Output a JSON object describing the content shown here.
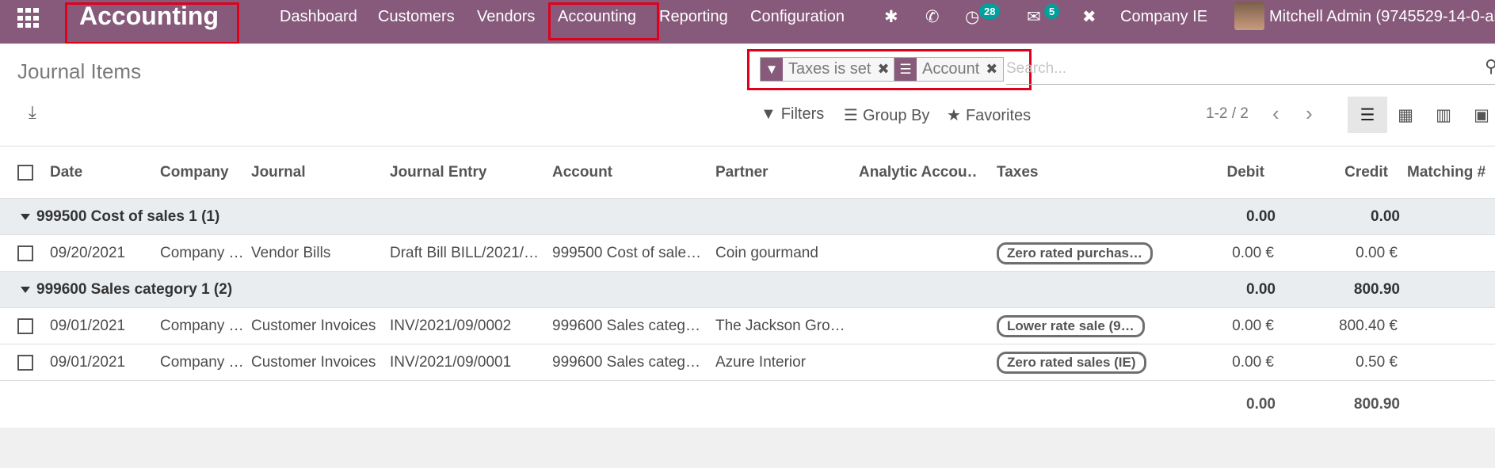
{
  "topbar": {
    "app_title": "Accounting",
    "menu": [
      "Dashboard",
      "Customers",
      "Vendors",
      "Accounting",
      "Reporting",
      "Configuration"
    ],
    "activity_count": "28",
    "message_count": "5",
    "company": "Company IE",
    "user": "Mitchell Admin (9745529-14-0-all"
  },
  "control": {
    "title": "Journal Items",
    "facets": [
      {
        "icon": "filter-icon",
        "label": "Taxes is set"
      },
      {
        "icon": "group-by-icon",
        "label": "Account"
      }
    ],
    "search_placeholder": "Search...",
    "filters_label": "Filters",
    "groupby_label": "Group By",
    "favorites_label": "Favorites",
    "pager": "1-2 / 2",
    "views": [
      "list-view-icon",
      "pivot-view-icon",
      "graph-view-icon",
      "kanban-view-icon"
    ]
  },
  "table": {
    "headers": [
      "Date",
      "Company",
      "Journal",
      "Journal Entry",
      "Account",
      "Partner",
      "Analytic Accou…",
      "Taxes",
      "Debit",
      "Credit",
      "Matching #"
    ],
    "groups": [
      {
        "label": "999500 Cost of sales 1 (1)",
        "debit": "0.00",
        "credit": "0.00",
        "rows": [
          {
            "date": "09/20/2021",
            "company": "Company …",
            "journal": "Vendor Bills",
            "entry": "Draft Bill BILL/2021/…",
            "account": "999500 Cost of sale…",
            "partner": "Coin gourmand",
            "analytic": "",
            "tax": "Zero rated purchas…",
            "debit": "0.00 €",
            "credit": "0.00 €",
            "matching": ""
          }
        ]
      },
      {
        "label": "999600 Sales category 1 (2)",
        "debit": "0.00",
        "credit": "800.90",
        "rows": [
          {
            "date": "09/01/2021",
            "company": "Company …",
            "journal": "Customer Invoices",
            "entry": "INV/2021/09/0002",
            "account": "999600 Sales categ…",
            "partner": "The Jackson Gro…",
            "analytic": "",
            "tax": "Lower rate sale (9…",
            "debit": "0.00 €",
            "credit": "800.40 €",
            "matching": ""
          },
          {
            "date": "09/01/2021",
            "company": "Company …",
            "journal": "Customer Invoices",
            "entry": "INV/2021/09/0001",
            "account": "999600 Sales categ…",
            "partner": "Azure Interior",
            "analytic": "",
            "tax": "Zero rated sales (IE)",
            "debit": "0.00 €",
            "credit": "0.50 €",
            "matching": ""
          }
        ]
      }
    ],
    "total_debit": "0.00",
    "total_credit": "800.90"
  }
}
